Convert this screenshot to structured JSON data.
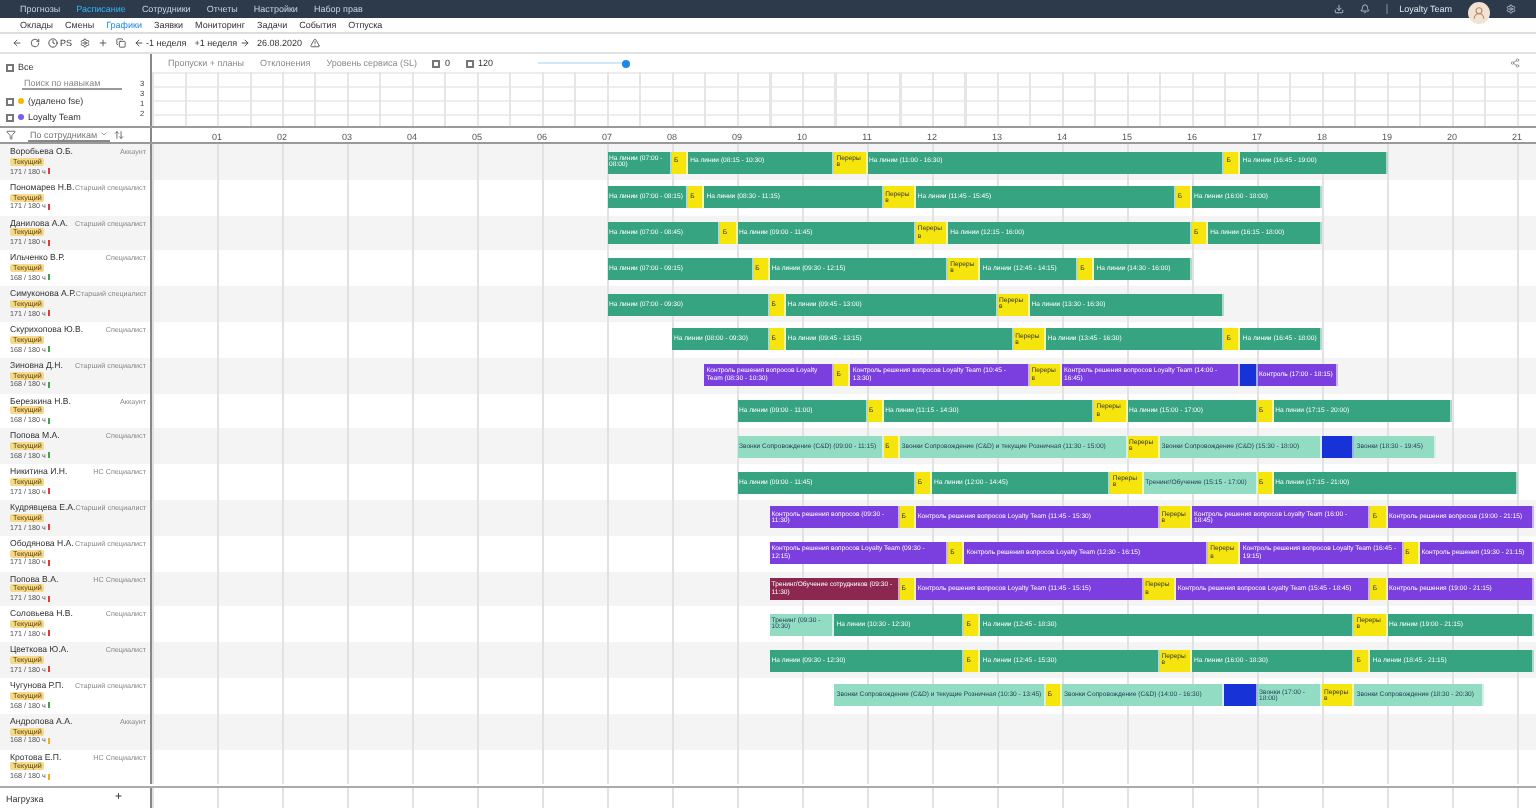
{
  "top_nav": [
    {
      "label": "Прогнозы",
      "selected": false
    },
    {
      "label": "Расписание",
      "selected": true
    },
    {
      "label": "Сотрудники",
      "selected": false
    },
    {
      "label": "Отчеты",
      "selected": false
    },
    {
      "label": "Настройки",
      "selected": false
    },
    {
      "label": "Набор прав",
      "selected": false
    }
  ],
  "user": {
    "name": "Loyalty Team"
  },
  "sub_nav": [
    {
      "label": "Оклады",
      "selected": false
    },
    {
      "label": "Смены",
      "selected": false
    },
    {
      "label": "Графики",
      "selected": true
    },
    {
      "label": "Заявки",
      "selected": false
    },
    {
      "label": "Мониторинг",
      "selected": false
    },
    {
      "label": "Задачи",
      "selected": false
    },
    {
      "label": "События",
      "selected": false
    },
    {
      "label": "Отпуска",
      "selected": false
    }
  ],
  "toolbar": {
    "mode": "PS",
    "prev": "-1 неделя",
    "next": "+1 неделя",
    "date": "26.08.2020"
  },
  "filters": {
    "all": {
      "label": "Все",
      "checked": false
    },
    "search": {
      "placeholder": "Поиск по навыкам"
    },
    "groups": [
      {
        "label": "(удалено fse)",
        "color": "#f5b800",
        "checked": false
      },
      {
        "label": "Loyalty Team",
        "color": "#7b5cf0",
        "checked": false
      }
    ],
    "counts": [
      "3",
      "3",
      "1",
      "2"
    ]
  },
  "chart_tabs": [
    "Пропуски + планы",
    "Отклонения",
    "Уровень сервиса (SL)"
  ],
  "chart_options": [
    {
      "label": "0",
      "checked": false
    },
    {
      "label": "120",
      "checked": false
    }
  ],
  "slider": {
    "level": 1
  },
  "grid": {
    "group_by": "По сотрудникам",
    "hours": [
      "01",
      "02",
      "03",
      "04",
      "05",
      "06",
      "07",
      "08",
      "09",
      "10",
      "11",
      "12",
      "13",
      "14",
      "15",
      "16",
      "17",
      "18",
      "19",
      "20",
      "21"
    ]
  },
  "employees": [
    {
      "name": "Воробьева О.Б.",
      "role": "Аккаунт",
      "tag": "Текущий",
      "hours": "171 / 180 ч",
      "color": "#e53935",
      "segments": [
        {
          "kind": "work",
          "label": "На линии",
          "time": "(07:00 - 08:00)"
        },
        {
          "kind": "break",
          "label": "Б"
        },
        {
          "kind": "work",
          "label": "На линии",
          "time": "(08:15 - 10:30)"
        },
        {
          "kind": "lunch",
          "label": "Перерыв"
        },
        {
          "kind": "work",
          "label": "На линии",
          "time": "(11:00 - 16:30)"
        },
        {
          "kind": "break",
          "label": "Б"
        },
        {
          "kind": "work",
          "label": "На линии",
          "time": "(16:45 - 19:00)"
        }
      ]
    },
    {
      "name": "Пономарев Н.В.",
      "role": "Старший специалист",
      "tag": "Текущий",
      "hours": "171 / 180 ч",
      "color": "#e53935",
      "segments": [
        {
          "kind": "work",
          "label": "На линии",
          "time": "(07:00 - 08:15)"
        },
        {
          "kind": "break",
          "label": "Б"
        },
        {
          "kind": "work",
          "label": "На линии",
          "time": "(08:30 - 11:15)"
        },
        {
          "kind": "lunch",
          "label": "Перерыв"
        },
        {
          "kind": "work",
          "label": "На линии",
          "time": "(11:45 - 15:45)"
        },
        {
          "kind": "break",
          "label": "Б"
        },
        {
          "kind": "work",
          "label": "На линии",
          "time": "(16:00 - 18:00)"
        }
      ]
    },
    {
      "name": "Данилова А.А.",
      "role": "Старший специалист",
      "tag": "Текущий",
      "hours": "171 / 180 ч",
      "color": "#e53935",
      "segments": [
        {
          "kind": "work",
          "label": "На линии",
          "time": "(07:00 - 08:45)"
        },
        {
          "kind": "break",
          "label": "Б"
        },
        {
          "kind": "work",
          "label": "На линии",
          "time": "(09:00 - 11:45)"
        },
        {
          "kind": "lunch",
          "label": "Перерыв"
        },
        {
          "kind": "work",
          "label": "На линии",
          "time": "(12:15 - 16:00)"
        },
        {
          "kind": "break",
          "label": "Б"
        },
        {
          "kind": "work",
          "label": "На линии",
          "time": "(16:15 - 18:00)"
        }
      ]
    },
    {
      "name": "Ильченко В.Р.",
      "role": "Специалист",
      "tag": "Текущий",
      "hours": "168 / 180 ч",
      "color": "#43a047",
      "segments": [
        {
          "kind": "work",
          "label": "На линии",
          "time": "(07:00 - 09:15)"
        },
        {
          "kind": "break",
          "label": "Б"
        },
        {
          "kind": "work",
          "label": "На линии",
          "time": "(09:30 - 12:15)"
        },
        {
          "kind": "lunch",
          "label": "Перерыв"
        },
        {
          "kind": "work",
          "label": "На линии",
          "time": "(12:45 - 14:15)"
        },
        {
          "kind": "break",
          "label": "Б"
        },
        {
          "kind": "work",
          "label": "На линии",
          "time": "(14:30 - 16:00)"
        }
      ]
    },
    {
      "name": "Симуконова А.Р.",
      "role": "Старший специалист",
      "tag": "Текущий",
      "hours": "171 / 180 ч",
      "color": "#e53935",
      "segments": [
        {
          "kind": "work",
          "label": "На линии",
          "time": "(07:00 - 09:30)"
        },
        {
          "kind": "break",
          "label": "Б"
        },
        {
          "kind": "work",
          "label": "На линии",
          "time": "(09:45 - 13:00)"
        },
        {
          "kind": "lunch",
          "label": "Перерыв"
        },
        {
          "kind": "work",
          "label": "На линии",
          "time": "(13:30 - 16:30)"
        }
      ]
    },
    {
      "name": "Скурихопова Ю.В.",
      "role": "Специалист",
      "tag": "Текущий",
      "hours": "168 / 180 ч",
      "color": "#43a047",
      "segments": [
        {
          "kind": "work",
          "label": "На линии",
          "time": "(08:00 - 09:30)"
        },
        {
          "kind": "break",
          "label": "Б"
        },
        {
          "kind": "work",
          "label": "На линии",
          "time": "(09:45 - 13:15)"
        },
        {
          "kind": "lunch",
          "label": "Перерыв"
        },
        {
          "kind": "work",
          "label": "На линии",
          "time": "(13:45 - 16:30)"
        },
        {
          "kind": "break",
          "label": "Б"
        },
        {
          "kind": "work",
          "label": "На линии",
          "time": "(16:45 - 18:00)"
        }
      ]
    },
    {
      "name": "Зиновна Д.Н.",
      "role": "Старший специалист",
      "tag": "Текущий",
      "hours": "168 / 180 ч",
      "color": "#43a047",
      "segments": [
        {
          "kind": "control",
          "label": "Контроль решения вопросов Loyalty Team",
          "time": "(08:30 - 10:30)"
        },
        {
          "kind": "break",
          "label": "Б"
        },
        {
          "kind": "control",
          "label": "Контроль решения вопросов Loyalty Team",
          "time": "(10:45 - 13:30)"
        },
        {
          "kind": "lunch",
          "label": "Перерыв"
        },
        {
          "kind": "control",
          "label": "Контроль решения вопросов Loyalty Team",
          "time": "(14:00 - 16:45)"
        },
        {
          "kind": "task"
        },
        {
          "kind": "control",
          "label": "Контроль",
          "time": "(17:00 - 18:15)"
        }
      ]
    },
    {
      "name": "Березкина Н.В.",
      "role": "Аккаунт",
      "tag": "Текущий",
      "hours": "168 / 180 ч",
      "color": "#43a047",
      "segments": [
        {
          "kind": "work",
          "label": "На линии",
          "time": "(09:00 - 11:00)"
        },
        {
          "kind": "break",
          "label": "Б"
        },
        {
          "kind": "work",
          "label": "На линии",
          "time": "(11:15 - 14:30)"
        },
        {
          "kind": "lunch",
          "label": "Перерыв"
        },
        {
          "kind": "work",
          "label": "На линии",
          "time": "(15:00 - 17:00)"
        },
        {
          "kind": "break",
          "label": "Б"
        },
        {
          "kind": "work",
          "label": "На линии",
          "time": "(17:15 - 20:00)"
        }
      ]
    },
    {
      "name": "Попова М.А.",
      "role": "Специалист",
      "tag": "Текущий",
      "hours": "168 / 180 ч",
      "color": "#43a047",
      "segments": [
        {
          "kind": "calls",
          "label": "Звонки Сопровождение (С&D)",
          "time": "(09:00 - 11:15)"
        },
        {
          "kind": "break",
          "label": "Б"
        },
        {
          "kind": "calls",
          "label": "Звонки Сопровождение (С&D) и текущие Розничная",
          "time": "(11:30 - 15:00)"
        },
        {
          "kind": "lunch",
          "label": "Перерыв"
        },
        {
          "kind": "calls",
          "label": "Звонки Сопровождение (С&D)",
          "time": "(15:30 - 18:00)"
        },
        {
          "kind": "task"
        },
        {
          "kind": "calls",
          "label": "Звонки",
          "time": "(18:30 - 19:45)"
        }
      ]
    },
    {
      "name": "Никитина И.Н.",
      "role": "НС Специалист",
      "tag": "Текущий",
      "hours": "171 / 180 ч",
      "color": "#e53935",
      "segments": [
        {
          "kind": "work",
          "label": "На линии",
          "time": "(09:00 - 11:45)"
        },
        {
          "kind": "break",
          "label": "Б"
        },
        {
          "kind": "work",
          "label": "На линии",
          "time": "(12:00 - 14:45)"
        },
        {
          "kind": "lunch",
          "label": "Перерыв"
        },
        {
          "kind": "calls",
          "label": "Тренинг/Обучение",
          "time": "(15:15 - 17:00)"
        },
        {
          "kind": "break",
          "label": "Б"
        },
        {
          "kind": "work",
          "label": "На линии",
          "time": "(17:15 - 21:00)"
        }
      ]
    },
    {
      "name": "Кудрявцева Е.А.",
      "role": "Старший специалист",
      "tag": "Текущий",
      "hours": "171 / 180 ч",
      "color": "#e53935",
      "segments": [
        {
          "kind": "control",
          "label": "Контроль решения вопросов",
          "time": "(09:30 - 11:30)"
        },
        {
          "kind": "break",
          "label": "Б"
        },
        {
          "kind": "control",
          "label": "Контроль решения вопросов Loyalty Team",
          "time": "(11:45 - 15:30)"
        },
        {
          "kind": "lunch",
          "label": "Перерыв"
        },
        {
          "kind": "control",
          "label": "Контроль решения вопросов Loyalty Team",
          "time": "(16:00 - 18:45)"
        },
        {
          "kind": "break",
          "label": "Б"
        },
        {
          "kind": "control",
          "label": "Контроль решения вопросов",
          "time": "(19:00 - 21:15)"
        }
      ]
    },
    {
      "name": "Ободянова Н.А.",
      "role": "Старший специалист",
      "tag": "Текущий",
      "hours": "171 / 180 ч",
      "color": "#e53935",
      "segments": [
        {
          "kind": "control",
          "label": "Контроль решения вопросов Loyalty Team",
          "time": "(09:30 - 12:15)"
        },
        {
          "kind": "break",
          "label": "Б"
        },
        {
          "kind": "control",
          "label": "Контроль решения вопросов Loyalty Team",
          "time": "(12:30 - 16:15)"
        },
        {
          "kind": "lunch",
          "label": "Перерыв"
        },
        {
          "kind": "control",
          "label": "Контроль решения вопросов Loyalty Team",
          "time": "(16:45 - 19:15)"
        },
        {
          "kind": "break",
          "label": "Б"
        },
        {
          "kind": "control",
          "label": "Контроль решения",
          "time": "(19:30 - 21:15)"
        }
      ]
    },
    {
      "name": "Попова В.А.",
      "role": "НС Специалист",
      "tag": "Текущий",
      "hours": "171 / 180 ч",
      "color": "#e53935",
      "segments": [
        {
          "kind": "training",
          "label": "Тренинг/Обучение сотрудников",
          "time": "(09:30 - 11:30)"
        },
        {
          "kind": "break",
          "label": "Б"
        },
        {
          "kind": "control",
          "label": "Контроль решения вопросов Loyalty Team",
          "time": "(11:45 - 15:15)"
        },
        {
          "kind": "lunch",
          "label": "Перерыв"
        },
        {
          "kind": "control",
          "label": "Контроль решения вопросов Loyalty Team",
          "time": "(15:45 - 18:45)"
        },
        {
          "kind": "break",
          "label": "Б"
        },
        {
          "kind": "control",
          "label": "Контроль решения",
          "time": "(19:00 - 21:15)"
        }
      ]
    },
    {
      "name": "Соловьева Н.В.",
      "role": "Специалист",
      "tag": "Текущий",
      "hours": "171 / 180 ч",
      "color": "#e53935",
      "segments": [
        {
          "kind": "calls",
          "label": "Тренинг",
          "time": "(09:30 - 10:30)"
        },
        {
          "kind": "work",
          "label": "На линии",
          "time": "(10:30 - 12:30)"
        },
        {
          "kind": "break",
          "label": "Б"
        },
        {
          "kind": "work",
          "label": "На линии",
          "time": "(12:45 - 18:30)"
        },
        {
          "kind": "lunch",
          "label": "Перерыв"
        },
        {
          "kind": "work",
          "label": "На линии",
          "time": "(19:00 - 21:15)"
        }
      ]
    },
    {
      "name": "Цветкова Ю.А.",
      "role": "Специалист",
      "tag": "Текущий",
      "hours": "171 / 180 ч",
      "color": "#e53935",
      "segments": [
        {
          "kind": "work",
          "label": "На линии",
          "time": "(09:30 - 12:30)"
        },
        {
          "kind": "break",
          "label": "Б"
        },
        {
          "kind": "work",
          "label": "На линии",
          "time": "(12:45 - 15:30)"
        },
        {
          "kind": "lunch",
          "label": "Перерыв"
        },
        {
          "kind": "work",
          "label": "На линии",
          "time": "(16:00 - 18:30)"
        },
        {
          "kind": "break",
          "label": "Б"
        },
        {
          "kind": "work",
          "label": "На линии",
          "time": "(18:45 - 21:15)"
        }
      ]
    },
    {
      "name": "Чугунова Р.П.",
      "role": "Старший специалист",
      "tag": "Текущий",
      "hours": "168 / 180 ч",
      "color": "#43a047",
      "segments": [
        {
          "kind": "calls",
          "label": "Звонки Сопровождение (С&D) и текущие Розничная",
          "time": "(10:30 - 13:45)"
        },
        {
          "kind": "break",
          "label": "Б"
        },
        {
          "kind": "calls",
          "label": "Звонки Сопровождение (С&D)",
          "time": "(14:00 - 16:30)"
        },
        {
          "kind": "task"
        },
        {
          "kind": "calls",
          "label": "Звонки",
          "time": "(17:00 - 18:00)"
        },
        {
          "kind": "lunch",
          "label": "Перерыв"
        },
        {
          "kind": "calls",
          "label": "Звонки Сопровождение",
          "time": "(18:30 - 20:30)"
        }
      ]
    },
    {
      "name": "Андропова А.А.",
      "role": "Аккаунт",
      "tag": "Текущий",
      "hours": "168 / 180 ч",
      "color": "#f9a825"
    },
    {
      "name": "Кротова Е.П.",
      "role": "НС Специалист",
      "tag": "Текущий",
      "hours": "168 / 180 ч",
      "color": "#f9a825"
    }
  ],
  "footer": {
    "label": "Нагрузка",
    "add": "+"
  }
}
